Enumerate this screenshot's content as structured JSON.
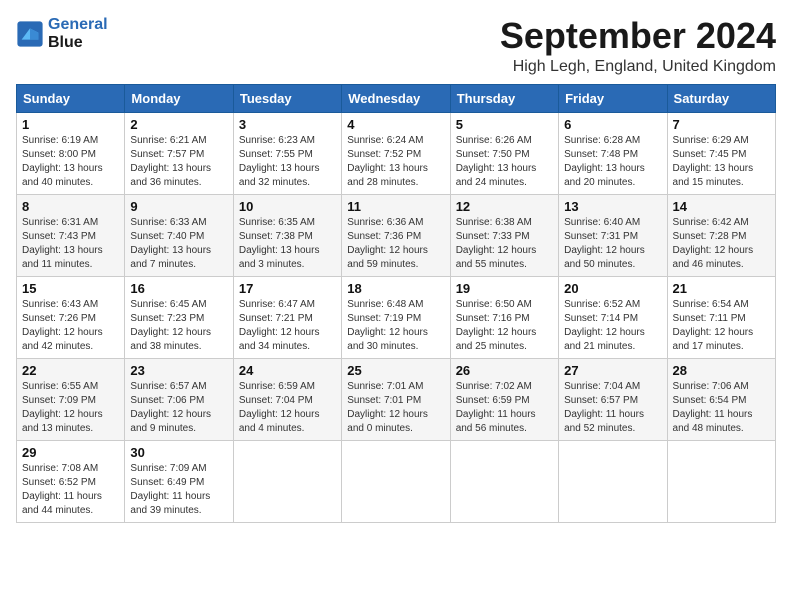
{
  "logo": {
    "line1": "General",
    "line2": "Blue"
  },
  "title": "September 2024",
  "location": "High Legh, England, United Kingdom",
  "days_of_week": [
    "Sunday",
    "Monday",
    "Tuesday",
    "Wednesday",
    "Thursday",
    "Friday",
    "Saturday"
  ],
  "weeks": [
    [
      {
        "day": "1",
        "sunrise": "6:19 AM",
        "sunset": "8:00 PM",
        "daylight": "13 hours and 40 minutes."
      },
      {
        "day": "2",
        "sunrise": "6:21 AM",
        "sunset": "7:57 PM",
        "daylight": "13 hours and 36 minutes."
      },
      {
        "day": "3",
        "sunrise": "6:23 AM",
        "sunset": "7:55 PM",
        "daylight": "13 hours and 32 minutes."
      },
      {
        "day": "4",
        "sunrise": "6:24 AM",
        "sunset": "7:52 PM",
        "daylight": "13 hours and 28 minutes."
      },
      {
        "day": "5",
        "sunrise": "6:26 AM",
        "sunset": "7:50 PM",
        "daylight": "13 hours and 24 minutes."
      },
      {
        "day": "6",
        "sunrise": "6:28 AM",
        "sunset": "7:48 PM",
        "daylight": "13 hours and 20 minutes."
      },
      {
        "day": "7",
        "sunrise": "6:29 AM",
        "sunset": "7:45 PM",
        "daylight": "13 hours and 15 minutes."
      }
    ],
    [
      {
        "day": "8",
        "sunrise": "6:31 AM",
        "sunset": "7:43 PM",
        "daylight": "13 hours and 11 minutes."
      },
      {
        "day": "9",
        "sunrise": "6:33 AM",
        "sunset": "7:40 PM",
        "daylight": "13 hours and 7 minutes."
      },
      {
        "day": "10",
        "sunrise": "6:35 AM",
        "sunset": "7:38 PM",
        "daylight": "13 hours and 3 minutes."
      },
      {
        "day": "11",
        "sunrise": "6:36 AM",
        "sunset": "7:36 PM",
        "daylight": "12 hours and 59 minutes."
      },
      {
        "day": "12",
        "sunrise": "6:38 AM",
        "sunset": "7:33 PM",
        "daylight": "12 hours and 55 minutes."
      },
      {
        "day": "13",
        "sunrise": "6:40 AM",
        "sunset": "7:31 PM",
        "daylight": "12 hours and 50 minutes."
      },
      {
        "day": "14",
        "sunrise": "6:42 AM",
        "sunset": "7:28 PM",
        "daylight": "12 hours and 46 minutes."
      }
    ],
    [
      {
        "day": "15",
        "sunrise": "6:43 AM",
        "sunset": "7:26 PM",
        "daylight": "12 hours and 42 minutes."
      },
      {
        "day": "16",
        "sunrise": "6:45 AM",
        "sunset": "7:23 PM",
        "daylight": "12 hours and 38 minutes."
      },
      {
        "day": "17",
        "sunrise": "6:47 AM",
        "sunset": "7:21 PM",
        "daylight": "12 hours and 34 minutes."
      },
      {
        "day": "18",
        "sunrise": "6:48 AM",
        "sunset": "7:19 PM",
        "daylight": "12 hours and 30 minutes."
      },
      {
        "day": "19",
        "sunrise": "6:50 AM",
        "sunset": "7:16 PM",
        "daylight": "12 hours and 25 minutes."
      },
      {
        "day": "20",
        "sunrise": "6:52 AM",
        "sunset": "7:14 PM",
        "daylight": "12 hours and 21 minutes."
      },
      {
        "day": "21",
        "sunrise": "6:54 AM",
        "sunset": "7:11 PM",
        "daylight": "12 hours and 17 minutes."
      }
    ],
    [
      {
        "day": "22",
        "sunrise": "6:55 AM",
        "sunset": "7:09 PM",
        "daylight": "12 hours and 13 minutes."
      },
      {
        "day": "23",
        "sunrise": "6:57 AM",
        "sunset": "7:06 PM",
        "daylight": "12 hours and 9 minutes."
      },
      {
        "day": "24",
        "sunrise": "6:59 AM",
        "sunset": "7:04 PM",
        "daylight": "12 hours and 4 minutes."
      },
      {
        "day": "25",
        "sunrise": "7:01 AM",
        "sunset": "7:01 PM",
        "daylight": "12 hours and 0 minutes."
      },
      {
        "day": "26",
        "sunrise": "7:02 AM",
        "sunset": "6:59 PM",
        "daylight": "11 hours and 56 minutes."
      },
      {
        "day": "27",
        "sunrise": "7:04 AM",
        "sunset": "6:57 PM",
        "daylight": "11 hours and 52 minutes."
      },
      {
        "day": "28",
        "sunrise": "7:06 AM",
        "sunset": "6:54 PM",
        "daylight": "11 hours and 48 minutes."
      }
    ],
    [
      {
        "day": "29",
        "sunrise": "7:08 AM",
        "sunset": "6:52 PM",
        "daylight": "11 hours and 44 minutes."
      },
      {
        "day": "30",
        "sunrise": "7:09 AM",
        "sunset": "6:49 PM",
        "daylight": "11 hours and 39 minutes."
      },
      null,
      null,
      null,
      null,
      null
    ]
  ]
}
